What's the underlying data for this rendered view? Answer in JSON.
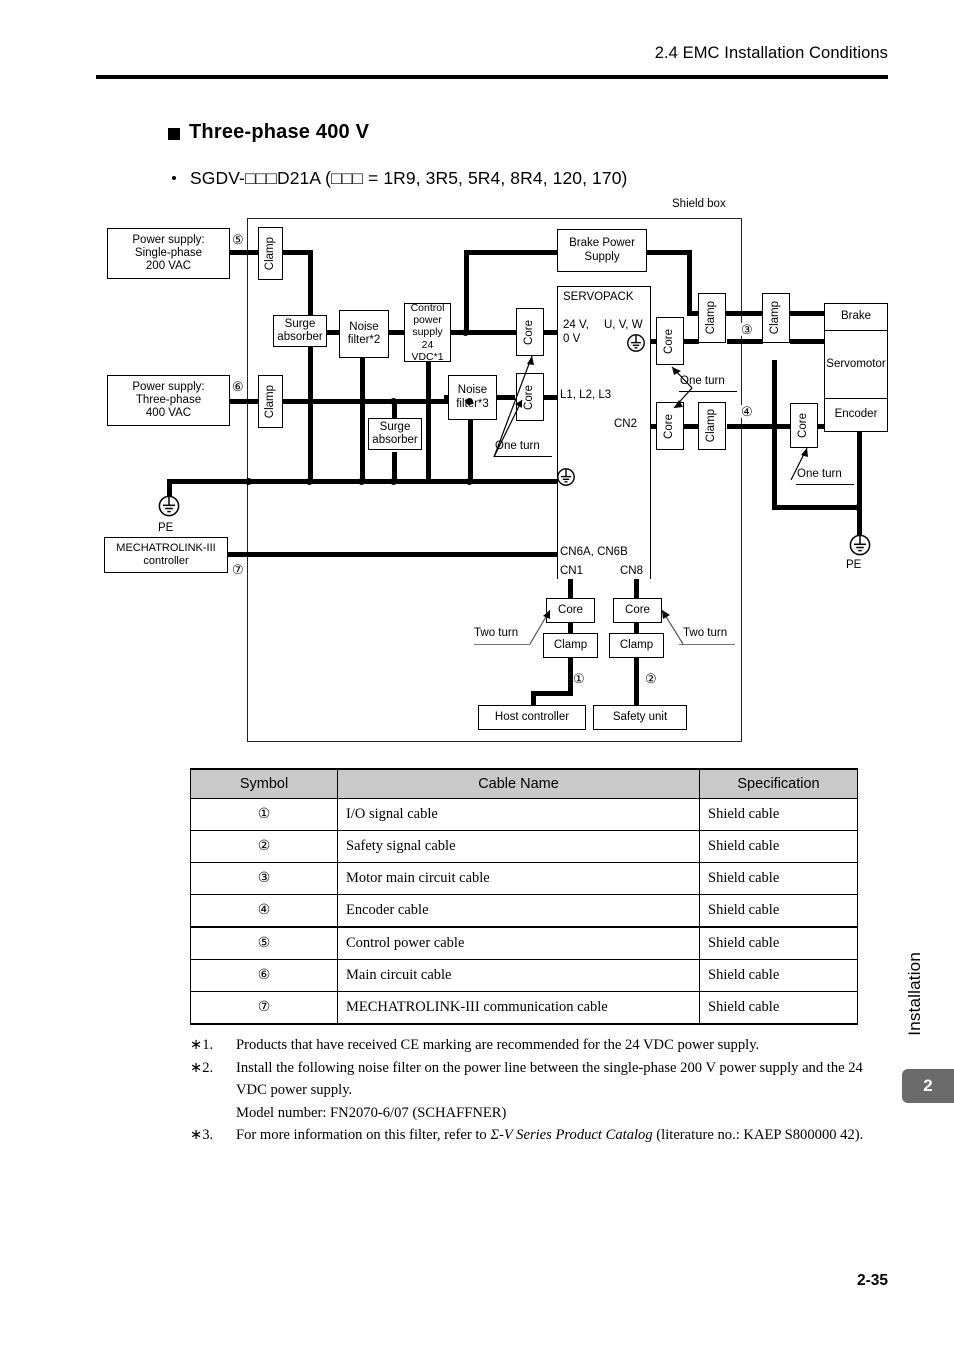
{
  "header": {
    "section_title": "2.4  EMC Installation Conditions"
  },
  "headings": {
    "main": "Three-phase 400 V",
    "model": "SGDV-□□□D21A (□□□ = 1R9, 3R5, 5R4, 8R4, 120, 170)"
  },
  "diagram": {
    "shield_box_label": "Shield box",
    "power_supply_single": "Power supply:\nSingle-phase\n200 VAC",
    "power_supply_single_lines": [
      "Power supply:",
      "Single-phase",
      "200 VAC"
    ],
    "power_supply_three_lines": [
      "Power supply:",
      "Three-phase",
      "400 VAC"
    ],
    "clamp": "Clamp",
    "core": "Core",
    "surge_absorber_lines": [
      "Surge",
      "absorber"
    ],
    "noise_filter_2_lines": [
      "Noise",
      "filter*2"
    ],
    "noise_filter_3_lines": [
      "Noise",
      "filter*3"
    ],
    "control_power_supply_lines": [
      "Control",
      "power",
      "supply",
      "24 VDC*1"
    ],
    "brake_power_supply_lines": [
      "Brake Power",
      "Supply"
    ],
    "servopack": "SERVOPACK",
    "servopack_24v_lines": [
      "24 V,",
      "0 V"
    ],
    "servopack_uvw": "U, V, W",
    "servopack_l123": "L1, L2, L3",
    "servopack_cn2": "CN2",
    "servopack_cn6": "CN6A, CN6B",
    "servopack_cn1": "CN1",
    "servopack_cn8": "CN8",
    "brake": "Brake",
    "servomotor": "Servomotor",
    "encoder": "Encoder",
    "mechatrolink_controller_lines": [
      "MECHATROLINK-III",
      "controller"
    ],
    "host_controller": "Host controller",
    "safety_unit": "Safety unit",
    "one_turn": "One turn",
    "two_turn": "Two turn",
    "pe": "PE",
    "symbols": {
      "s1": "①",
      "s2": "②",
      "s3": "③",
      "s4": "④",
      "s5": "⑤",
      "s6": "⑥",
      "s7": "⑦"
    }
  },
  "table": {
    "headers": [
      "Symbol",
      "Cable Name",
      "Specification"
    ],
    "rows": [
      {
        "symbol": "①",
        "name": "I/O signal cable",
        "spec": "Shield cable"
      },
      {
        "symbol": "②",
        "name": "Safety signal cable",
        "spec": "Shield cable"
      },
      {
        "symbol": "③",
        "name": "Motor main circuit cable",
        "spec": "Shield cable"
      },
      {
        "symbol": "④",
        "name": "Encoder cable",
        "spec": "Shield cable"
      },
      {
        "symbol": "⑤",
        "name": "Control power cable",
        "spec": "Shield cable"
      },
      {
        "symbol": "⑥",
        "name": "Main circuit cable",
        "spec": "Shield cable"
      },
      {
        "symbol": "⑦",
        "name": "MECHATROLINK-III communication cable",
        "spec": "Shield cable"
      }
    ]
  },
  "footnotes": [
    {
      "marker": "∗1.",
      "text": "Products that have received CE marking are recommended for the 24 VDC power supply."
    },
    {
      "marker": "∗2.",
      "text": "Install the following noise filter on the power line between the single-phase 200 V power supply and the 24 VDC power supply.",
      "text2": "Model number: FN2070-6/07 (SCHAFFNER)"
    },
    {
      "marker": "∗3.",
      "text_before": "For more information on this filter, refer to ",
      "text_italic": "Σ-V Series Product Catalog",
      "text_after": " (literature no.: KAEP S800000 42)."
    }
  ],
  "sidebar": {
    "section_name": "Installation",
    "chapter": "2"
  },
  "footer": {
    "page": "2-35"
  }
}
